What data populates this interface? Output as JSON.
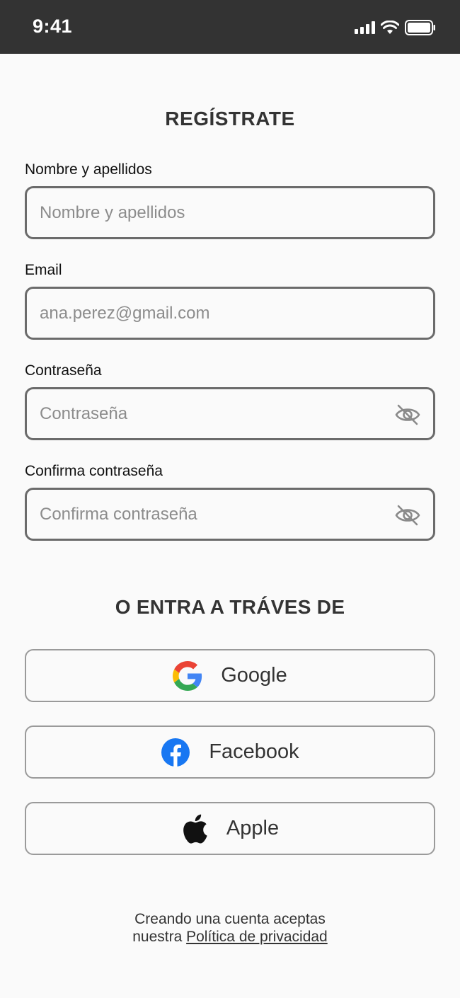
{
  "status_bar": {
    "time": "9:41"
  },
  "title": "REGÍSTRATE",
  "fields": {
    "name": {
      "label": "Nombre y apellidos",
      "placeholder": "Nombre y apellidos"
    },
    "email": {
      "label": "Email",
      "placeholder": "ana.perez@gmail.com"
    },
    "password": {
      "label": "Contraseña",
      "placeholder": "Contraseña"
    },
    "confirm": {
      "label": "Confirma contraseña",
      "placeholder": "Confirma contraseña"
    }
  },
  "social": {
    "heading": "O ENTRA A TRÁVES DE",
    "google": "Google",
    "facebook": "Facebook",
    "apple": "Apple"
  },
  "footer": {
    "line1": "Creando una cuenta aceptas",
    "line2_prefix": "nuestra",
    "privacy_link": "Política de privacidad"
  },
  "colors": {
    "status_bar": "#333333",
    "field_border": "#6b6b6b",
    "facebook": "#1877F2"
  }
}
